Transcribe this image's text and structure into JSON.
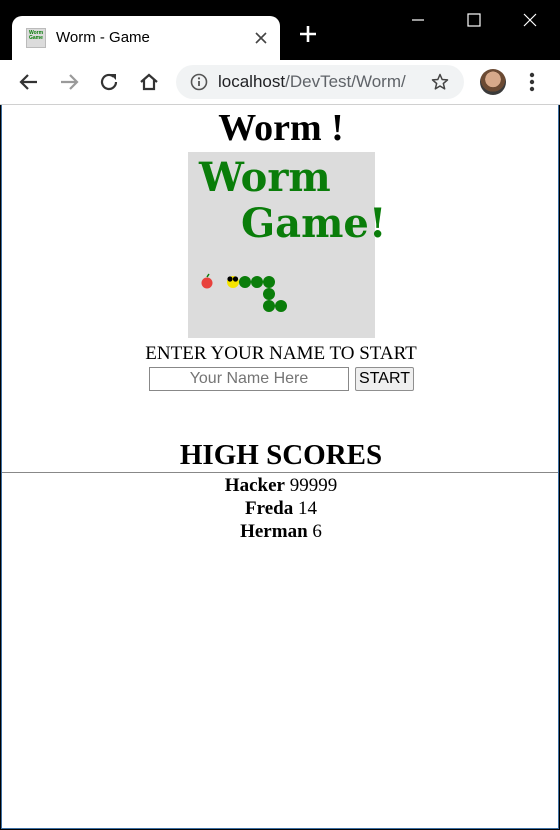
{
  "browser": {
    "tab_title": "Worm - Game",
    "favicon_text": "Worm Game",
    "url_host": "localhost",
    "url_path": "/DevTest/Worm/"
  },
  "page": {
    "title": "Worm !",
    "logo": {
      "line1": "Worm",
      "line2": "Game!"
    },
    "prompt": "ENTER YOUR NAME TO START",
    "name_placeholder": "Your Name Here",
    "start_label": "START",
    "scores_heading": "HIGH SCORES",
    "scores": [
      {
        "name": "Hacker",
        "score": "99999"
      },
      {
        "name": "Freda",
        "score": "14"
      },
      {
        "name": "Herman",
        "score": "6"
      }
    ]
  },
  "colors": {
    "worm_green": "#0a7d0a",
    "apple_red": "#e8413c",
    "logo_bg": "#dcdcdc",
    "worm_head": "#f5e400"
  },
  "icons": [
    "close-icon",
    "plus-icon",
    "minimize-icon",
    "maximize-icon",
    "back-icon",
    "forward-icon",
    "reload-icon",
    "home-icon",
    "info-icon",
    "star-icon",
    "menu-icon"
  ]
}
